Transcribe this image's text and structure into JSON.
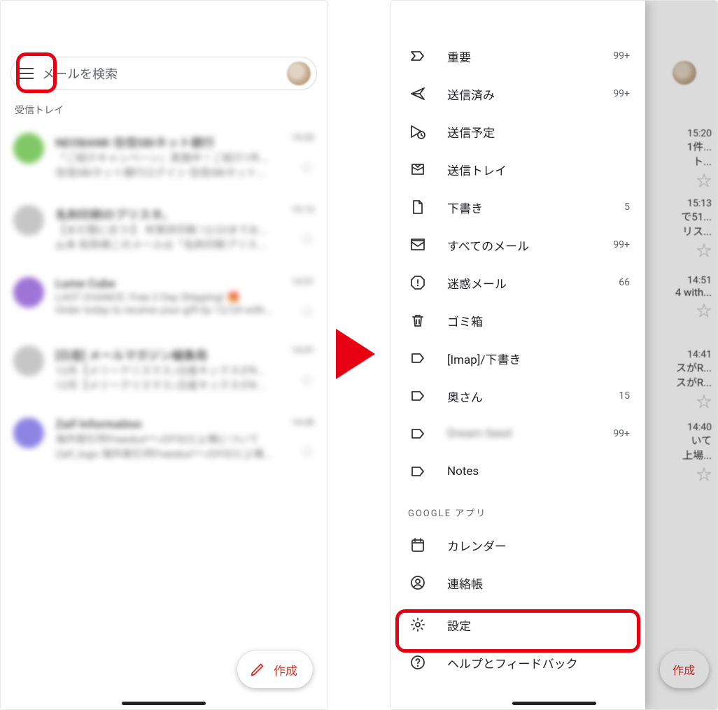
{
  "left": {
    "search_placeholder": "メールを検索",
    "inbox_label": "受信トレイ",
    "compose_label": "作成",
    "emails": [
      {
        "avatar_color": "#6bbf4b",
        "sender": "NEOBANK 住信SBIネット銀行",
        "line2": "「ご紹介キャンペーン」実施中！ご紹介1件...",
        "line3": "住信SBIネット銀行ログイン 住信SBIネット...",
        "time": "15:20"
      },
      {
        "avatar_color": "#bdbdbd",
        "sender": "名刺印刷のプリスタ。",
        "line2": "【まだ間に合う!】 年賀状印刷 12/23までお...",
        "line3": "山本 拓弥様このメールは「名刺印刷プリス...",
        "time": "15:13"
      },
      {
        "avatar_color": "#8e5ccf",
        "sender": "Lume Cube",
        "line2": "LAST CHANCE: Free 2 Day Shipping! 🎁",
        "line3": "Order today to receive your gift by 12/24 with...",
        "time": "14:51"
      },
      {
        "avatar_color": "#bdbdbd",
        "sender": "[日産] メールマガジン編集局",
        "line2": "12月【メリークリスマス♪日産キックスがR...",
        "line3": "12月【メリークリスマス♪日産キックスがR...",
        "time": "14:41"
      },
      {
        "avatar_color": "#7b6fe0",
        "sender": "Zaif Information",
        "line2": "海外取引所Freedos*へのFSCC上場について",
        "line3": "Zaif_logo 海外取引所Freedos*へのFSCC上場...",
        "time": "14:40"
      }
    ]
  },
  "right": {
    "compose_label": "作成",
    "bg_rows": [
      {
        "time": "15:20",
        "snippet": "1件...",
        "snippet2": "ト..."
      },
      {
        "time": "15:13",
        "snippet": "で51...",
        "snippet2": "リス..."
      },
      {
        "time": "14:51",
        "snippet": "4 with..."
      },
      {
        "time": "14:41",
        "snippet": "スがR...",
        "snippet2": "スがR..."
      },
      {
        "time": "14:40",
        "snippet": "いて",
        "snippet2": "上場..."
      }
    ],
    "section_label": "GOOGLE アプリ",
    "drawer": [
      {
        "icon": "important",
        "label": "重要",
        "count": "99+"
      },
      {
        "icon": "sent",
        "label": "送信済み",
        "count": "99+"
      },
      {
        "icon": "scheduled",
        "label": "送信予定",
        "count": ""
      },
      {
        "icon": "outbox",
        "label": "送信トレイ",
        "count": ""
      },
      {
        "icon": "draft",
        "label": "下書き",
        "count": "5"
      },
      {
        "icon": "allmail",
        "label": "すべてのメール",
        "count": "99+"
      },
      {
        "icon": "spam",
        "label": "迷惑メール",
        "count": "66"
      },
      {
        "icon": "trash",
        "label": "ゴミ箱",
        "count": ""
      },
      {
        "icon": "label",
        "label": "[Imap]/下書き",
        "count": ""
      },
      {
        "icon": "label",
        "label": "奥さん",
        "count": "15"
      },
      {
        "icon": "label",
        "label": "Dream Seed",
        "count": "99+",
        "blurred": true
      },
      {
        "icon": "label",
        "label": "Notes",
        "count": ""
      }
    ],
    "apps": [
      {
        "icon": "calendar",
        "label": "カレンダー"
      },
      {
        "icon": "contacts",
        "label": "連絡帳"
      }
    ],
    "footer": [
      {
        "icon": "settings",
        "label": "設定"
      },
      {
        "icon": "help",
        "label": "ヘルプとフィードバック"
      }
    ]
  }
}
